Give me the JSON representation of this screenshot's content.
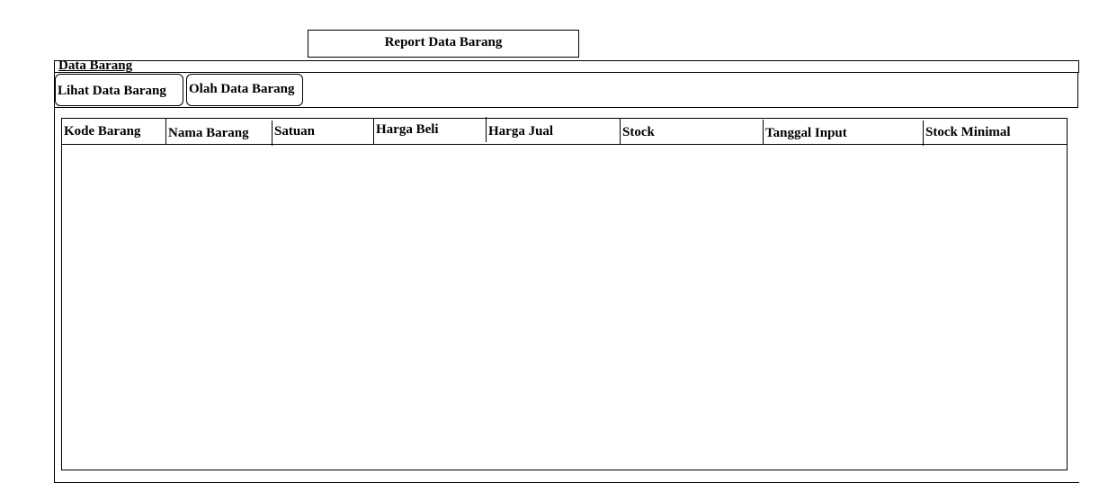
{
  "report_button": {
    "label": "Report Data Barang"
  },
  "panel": {
    "title": "Data Barang"
  },
  "tabs": [
    {
      "label": "Lihat Data Barang"
    },
    {
      "label": "Olah Data Barang"
    }
  ],
  "table": {
    "columns": [
      "Kode Barang",
      "Nama Barang",
      "Satuan",
      "Harga Beli",
      "Harga Jual",
      "Stock",
      "Tanggal Input",
      "Stock Minimal"
    ],
    "rows": []
  }
}
